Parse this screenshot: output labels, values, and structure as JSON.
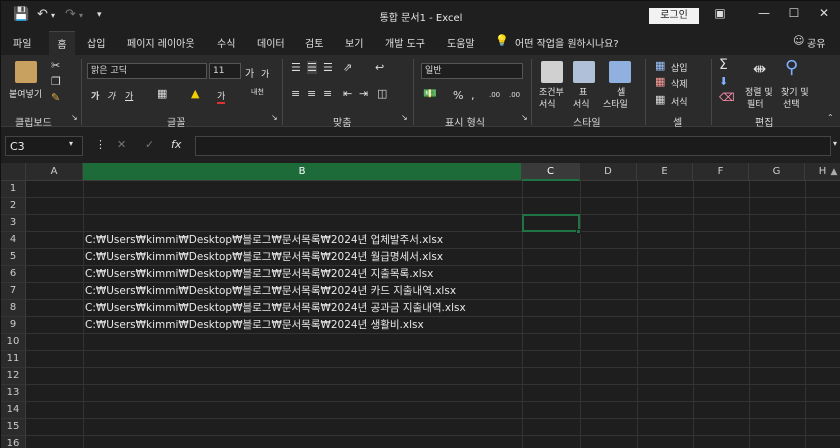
{
  "window": {
    "title": "통합 문서1  -  Excel",
    "login_label": "로그인",
    "minimize_icon": "minimize-icon",
    "maximize_icon": "maximize-icon",
    "close_icon": "close-icon"
  },
  "quick_access": {
    "save_icon": "save-icon",
    "undo_icon": "undo-icon",
    "redo_icon": "redo-icon"
  },
  "tabs": [
    "파일",
    "홈",
    "삽입",
    "페이지 레이아웃",
    "수식",
    "데이터",
    "검토",
    "보기",
    "개발 도구",
    "도움말"
  ],
  "active_tab": "홈",
  "tell_me": "어떤 작업을 원하시나요?",
  "share_label": "공유",
  "ribbon": {
    "clipboard": {
      "paste_label": "붙여넣기",
      "group_label": "클립보드"
    },
    "font": {
      "font_name": "맑은 고딕",
      "font_size": "11",
      "grow": "가",
      "shrink": "가",
      "bold": "가",
      "italic": "가",
      "underline": "가",
      "font_color": "가",
      "phonetic": "내천",
      "group_label": "글꼴"
    },
    "alignment": {
      "group_label": "맞춤"
    },
    "number": {
      "format": "일반",
      "percent": "%",
      "comma": ",",
      "inc_decimal": ".00",
      "dec_decimal": ".00",
      "group_label": "표시 형식"
    },
    "styles": {
      "conditional": "조건부",
      "conditional2": "서식",
      "table": "표",
      "table2": "서식",
      "cell_styles": "셀",
      "cell_styles2": "스타일",
      "group_label": "스타일"
    },
    "cells": {
      "insert": "삽입",
      "delete": "삭제",
      "format": "서식",
      "group_label": "셀"
    },
    "editing": {
      "sum": "Σ",
      "sort": "정렬 및",
      "sort2": "필터",
      "find": "찾기 및",
      "find2": "선택",
      "group_label": "편집"
    }
  },
  "formula_bar": {
    "name_box": "C3",
    "fx_label": "fx",
    "cancel_icon": "cancel-icon",
    "enter_icon": "check-icon",
    "value": ""
  },
  "columns": [
    "A",
    "B",
    "C",
    "D",
    "E",
    "F",
    "G",
    "H"
  ],
  "rows": [
    "1",
    "2",
    "3",
    "4",
    "5",
    "6",
    "7",
    "8",
    "9",
    "10",
    "11",
    "12",
    "13",
    "14",
    "15",
    "16"
  ],
  "active_cell": "C3",
  "selected_column": "B",
  "cells": [
    {
      "row": "4",
      "text": "C:₩Users₩kimmi₩Desktop₩블로그₩문서목록₩2024년 업체발주서.xlsx"
    },
    {
      "row": "5",
      "text": "C:₩Users₩kimmi₩Desktop₩블로그₩문서목록₩2024년 월급명세서.xlsx"
    },
    {
      "row": "6",
      "text": "C:₩Users₩kimmi₩Desktop₩블로그₩문서목록₩2024년 지출목록.xlsx"
    },
    {
      "row": "7",
      "text": "C:₩Users₩kimmi₩Desktop₩블로그₩문서목록₩2024년 카드 지출내역.xlsx"
    },
    {
      "row": "8",
      "text": "C:₩Users₩kimmi₩Desktop₩블로그₩문서목록₩2024년 공과금 지출내역.xlsx"
    },
    {
      "row": "9",
      "text": "C:₩Users₩kimmi₩Desktop₩블로그₩문서목록₩2024년 생활비.xlsx"
    }
  ]
}
